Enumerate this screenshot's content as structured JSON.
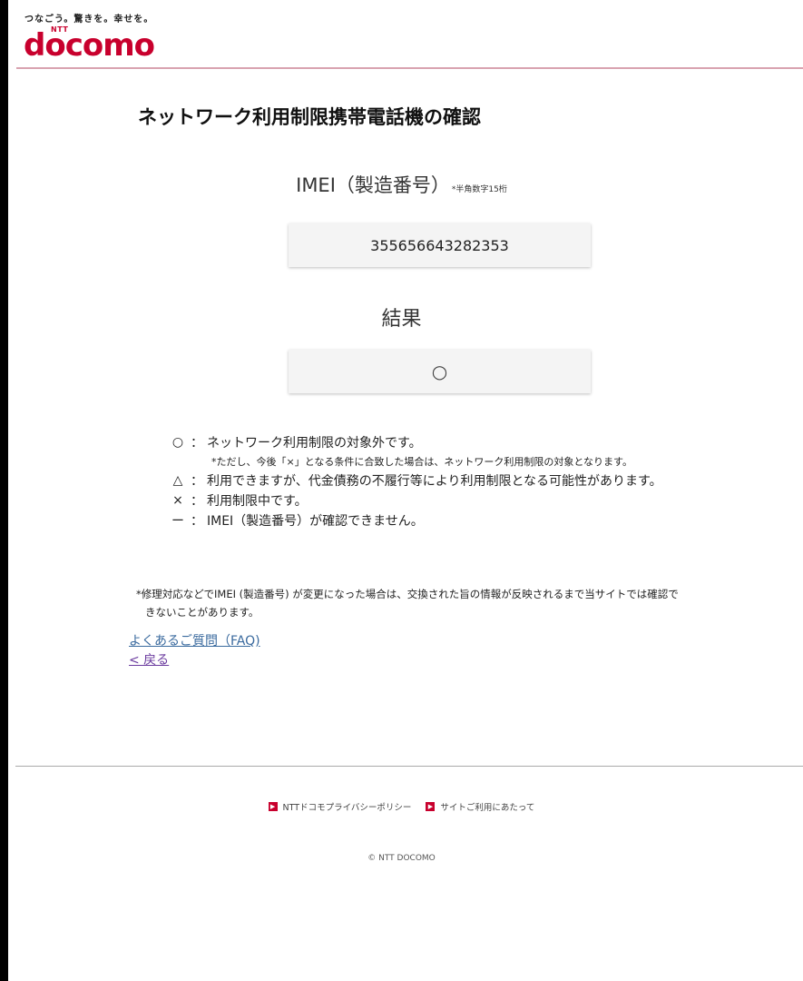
{
  "header": {
    "tagline": "つなごう。驚きを。幸せを。",
    "logo_ntt": "NTT",
    "logo_word": "docomo"
  },
  "page": {
    "title": "ネットワーク利用制限携帯電話機の確認"
  },
  "imei": {
    "label": "IMEI（製造番号）",
    "note": "*半角数字15桁",
    "value": "355656643282353"
  },
  "result": {
    "label": "結果",
    "value": "○"
  },
  "legend": {
    "items": [
      {
        "symbol": "○",
        "colon": "：",
        "text": "ネットワーク利用制限の対象外です。"
      },
      {
        "symbol": "△",
        "colon": "：",
        "text": "利用できますが、代金債務の不履行等により利用制限となる可能性があります。"
      },
      {
        "symbol": "×",
        "colon": "：",
        "text": "利用制限中です。"
      },
      {
        "symbol": "ー",
        "colon": "：",
        "text": "IMEI（製造番号）が確認できません。"
      }
    ],
    "sub_note": "*ただし、今後「×」となる条件に合致した場合は、ネットワーク利用制限の対象となります。"
  },
  "notice": {
    "line1": "*修理対応などでIMEI (製造番号) が変更になった場合は、交換された旨の情報が反映されるまで当サイトでは確認で",
    "line2": "きないことがあります。"
  },
  "links": {
    "faq": "よくあるご質問（FAQ)",
    "back": "< 戻る"
  },
  "footer": {
    "privacy": "NTTドコモプライバシーポリシー",
    "terms": "サイトご利用にあたって",
    "copyright": "© NTT DOCOMO"
  },
  "colors": {
    "brand": "#c8002d",
    "link": "#3a6a9e",
    "visited_link": "#6a3a9e"
  }
}
